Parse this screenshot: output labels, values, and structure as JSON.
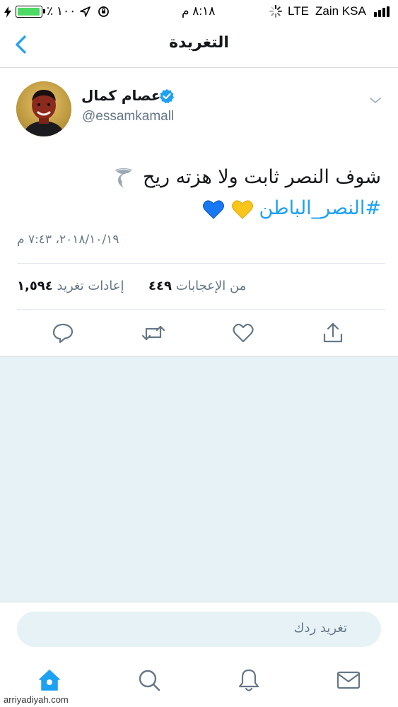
{
  "status_bar": {
    "carrier": "Zain KSA",
    "network": "LTE",
    "time": "٨:١٨ م",
    "battery_percent": "٪ ١٠٠",
    "battery_level": 1.0
  },
  "nav": {
    "title": "التغريدة"
  },
  "tweet": {
    "author_name": "عصام كمال",
    "author_handle": "@essamkamall",
    "verified": true,
    "text_line1": "شوف النصر ثابت ولا هزته ريح",
    "hashtag": "#النصر_الباطن",
    "timestamp": "٢٠١٨/١٠/١٩، ٧:٤٣ م",
    "retweets_count": "١,٥٩٤",
    "retweets_label": "إعادات تغريد",
    "likes_count": "٤٤٩",
    "likes_label": "من الإعجابات"
  },
  "composer": {
    "placeholder": "تغريد ردك"
  },
  "watermark": "arriyadiyah.com",
  "colors": {
    "accent": "#1da1f2",
    "battery": "#4cd964",
    "feed_background": "#e6f2f5",
    "secondary_text": "#657786"
  },
  "icons": {
    "back": "chevron-left-icon",
    "caret": "chevron-down-icon",
    "reply": "reply-icon",
    "retweet": "retweet-icon",
    "like": "heart-icon",
    "share": "share-icon",
    "home": "home-icon",
    "search": "search-icon",
    "notifications": "bell-icon",
    "messages": "mail-icon"
  }
}
